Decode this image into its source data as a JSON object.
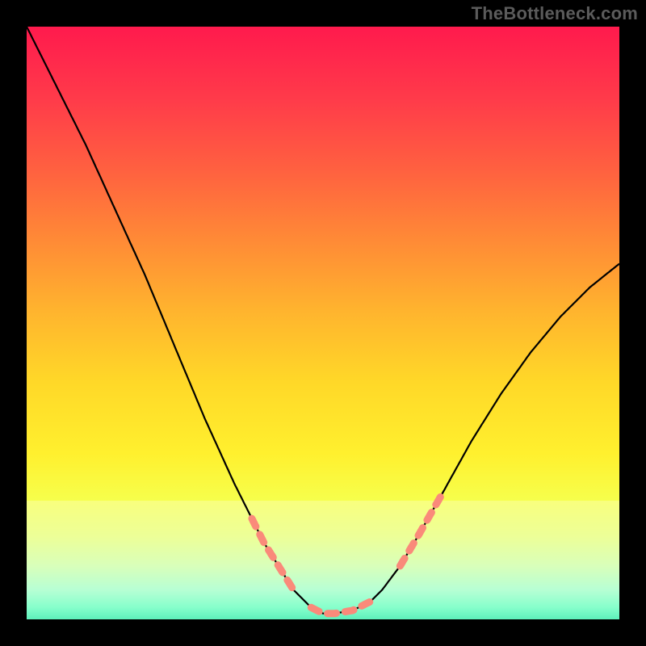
{
  "watermark": "TheBottleneck.com",
  "chart_data": {
    "type": "line",
    "title": "",
    "xlabel": "",
    "ylabel": "",
    "xlim": [
      0,
      100
    ],
    "ylim": [
      0,
      100
    ],
    "series": [
      {
        "name": "curve",
        "x": [
          0,
          5,
          10,
          15,
          20,
          25,
          30,
          35,
          40,
          45,
          48,
          50,
          52,
          55,
          58,
          60,
          63,
          66,
          70,
          75,
          80,
          85,
          90,
          95,
          100
        ],
        "values": [
          100,
          90,
          80,
          69,
          58,
          46,
          34,
          23,
          13,
          5,
          2,
          1,
          1,
          1.5,
          3,
          5,
          9,
          14,
          21,
          30,
          38,
          45,
          51,
          56,
          60
        ]
      }
    ],
    "highlight_band_y": [
      0,
      20
    ],
    "segments_on_curve": [
      {
        "name": "left-segment",
        "x_from": 38,
        "x_to": 45
      },
      {
        "name": "valley-segment",
        "x_from": 48,
        "x_to": 58
      },
      {
        "name": "right-segment",
        "x_from": 63,
        "x_to": 70
      }
    ],
    "colors": {
      "segment": "#fa8a7a",
      "curve": "#000000"
    }
  }
}
